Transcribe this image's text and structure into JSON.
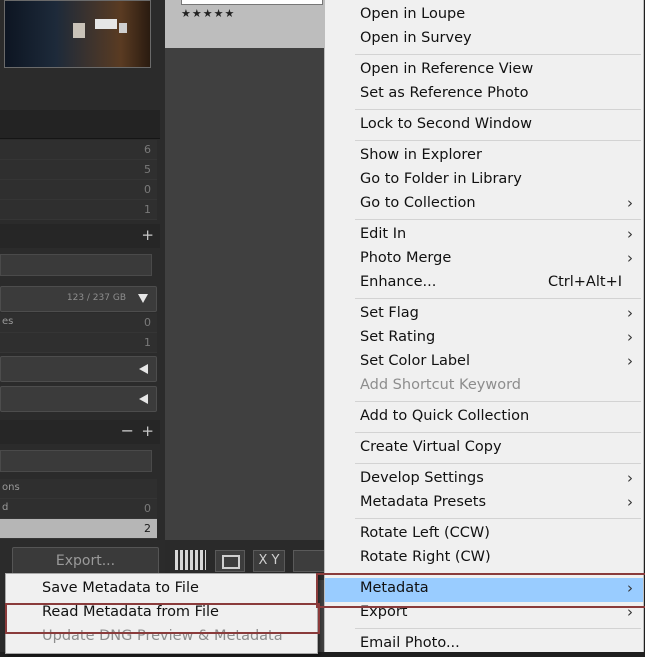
{
  "left_panel": {
    "rows_top": [
      {
        "label": "",
        "count": "6"
      },
      {
        "label": "",
        "count": "5"
      },
      {
        "label": "",
        "count": "0"
      },
      {
        "label": "",
        "count": "1"
      }
    ],
    "drive_info": "123 / 237 GB",
    "folder_rows": [
      {
        "label": "es",
        "count": "0"
      },
      {
        "label": "",
        "count": "1"
      }
    ],
    "collection_rows": [
      {
        "label": "ons",
        "count": ""
      },
      {
        "label": "d",
        "count": "0"
      },
      {
        "label": "",
        "count": "2"
      }
    ],
    "export_label": "Export..."
  },
  "grid": {
    "rating_stars": "★★★★★",
    "view_xy_label": "X Y"
  },
  "context_menu": {
    "items": [
      {
        "label": "Open in Loupe"
      },
      {
        "label": "Open in Survey"
      },
      {
        "label": "Open in Reference View"
      },
      {
        "label": "Set as Reference Photo"
      },
      {
        "label": "Lock to Second Window"
      },
      {
        "label": "Show in Explorer"
      },
      {
        "label": "Go to Folder in Library"
      },
      {
        "label": "Go to Collection",
        "arrow": "›"
      },
      {
        "label": "Edit In",
        "arrow": "›"
      },
      {
        "label": "Photo Merge",
        "arrow": "›"
      },
      {
        "label": "Enhance...",
        "shortcut": "Ctrl+Alt+I"
      },
      {
        "label": "Set Flag",
        "arrow": "›"
      },
      {
        "label": "Set Rating",
        "arrow": "›"
      },
      {
        "label": "Set Color Label",
        "arrow": "›"
      },
      {
        "label": "Add Shortcut Keyword"
      },
      {
        "label": "Add to Quick Collection"
      },
      {
        "label": "Create Virtual Copy"
      },
      {
        "label": "Develop Settings",
        "arrow": "›"
      },
      {
        "label": "Metadata Presets",
        "arrow": "›"
      },
      {
        "label": "Rotate Left (CCW)"
      },
      {
        "label": "Rotate Right (CW)"
      },
      {
        "label": "Metadata",
        "arrow": "›"
      },
      {
        "label": "Export",
        "arrow": "›"
      },
      {
        "label": "Email Photo..."
      }
    ]
  },
  "metadata_submenu": {
    "items": [
      {
        "label": "Save Metadata to File"
      },
      {
        "label": "Read Metadata from File"
      },
      {
        "label": "Update DNG Preview & Metadata"
      }
    ]
  },
  "colors": {
    "highlight": "#99ccff",
    "annotation_red": "#8a3b3b",
    "menu_bg": "#f0f0f0",
    "disabled_text": "#8d8d8d"
  }
}
